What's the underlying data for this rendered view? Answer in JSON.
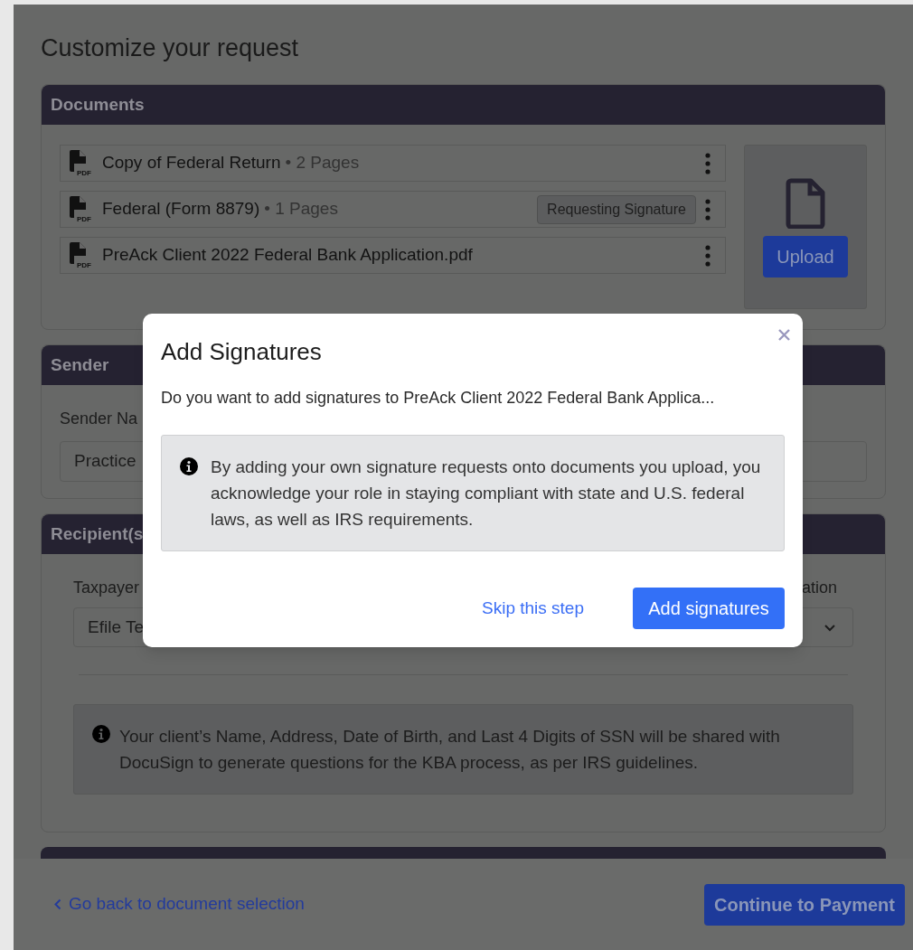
{
  "page": {
    "title": "Customize your request"
  },
  "documents": {
    "header": "Documents",
    "items": [
      {
        "name": "Copy of Federal Return",
        "pages": "• 2 Pages",
        "file_badge": "PDF"
      },
      {
        "name": "Federal (Form 8879)",
        "pages": "• 1 Pages",
        "file_badge": "PDF",
        "tag": "Requesting Signature"
      },
      {
        "name": "PreAck Client 2022 Federal Bank Application.pdf",
        "file_badge": "PDF"
      }
    ],
    "upload_button": "Upload"
  },
  "sender": {
    "header": "Sender",
    "label": "Sender Na",
    "field_value": "Practice"
  },
  "recipients": {
    "header": "Recipient(s",
    "label_1": "Taxpayer",
    "field_1_value": "Efile Te",
    "label_3": "ation",
    "note": "Your client’s Name, Address, Date of Birth, and Last 4 Digits of SSN will be shared with DocuSign to generate questions for the KBA process, as per IRS guidelines."
  },
  "footer": {
    "back_link": "Go back to document selection",
    "continue_button": "Continue to Payment"
  },
  "dialog": {
    "title": "Add Signatures",
    "message": "Do you want to add signatures to PreAck Client 2022 Federal Bank Applica...",
    "notice": "By adding your own signature requests onto documents you upload, you acknowledge your role in staying compliant with state and U.S. federal laws, as well as IRS requirements.",
    "skip_link": "Skip this step",
    "confirm_button": "Add signatures"
  }
}
